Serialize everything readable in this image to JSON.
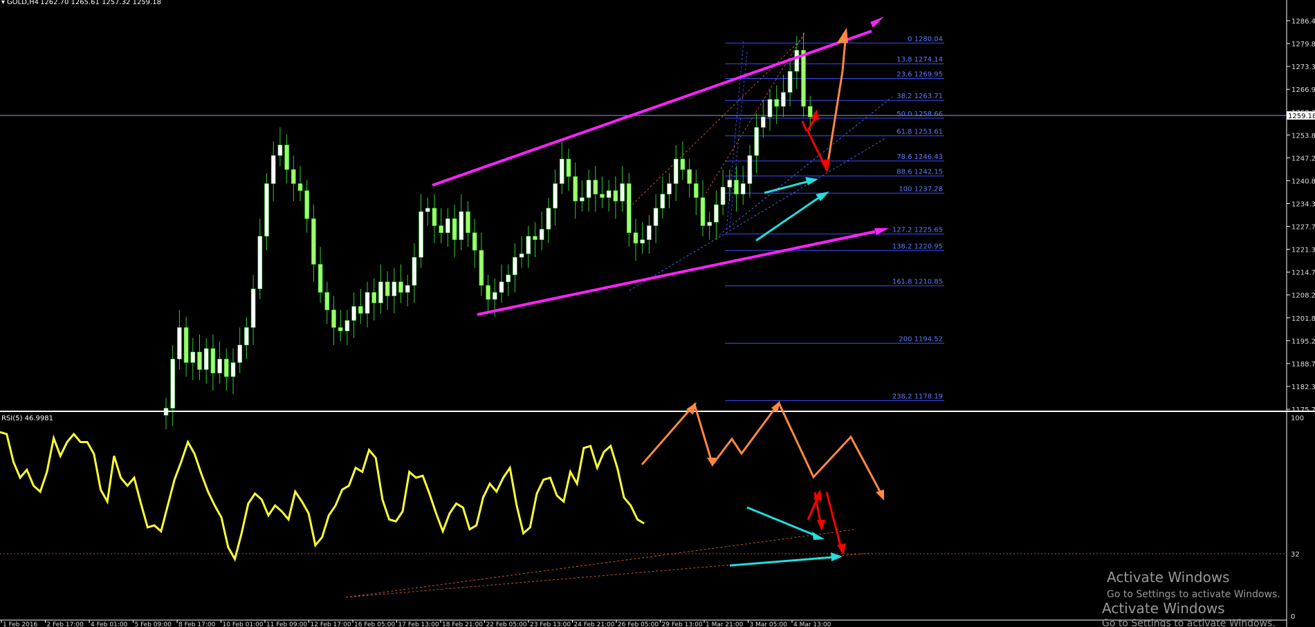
{
  "header": {
    "symbol": "GOLD,H4",
    "ohlc": "1262.70 1265.61 1257.32 1259.18"
  },
  "price_axis": {
    "ticks": [
      "1286.40",
      "1279.80",
      "1273.35",
      "1266.90",
      "1260.30",
      "1253.85",
      "1247.25",
      "1240.80",
      "1234.35",
      "1227.75",
      "1221.30",
      "1214.70",
      "1208.25",
      "1201.80",
      "1195.20",
      "1188.75",
      "1182.30",
      "1175.70"
    ],
    "current_price": "1259.18"
  },
  "rsi": {
    "label": "RSI(5) 46.9981",
    "levels": [
      "100",
      "32",
      "0"
    ]
  },
  "time_axis": {
    "labels": [
      "1 Feb 2016",
      "2 Feb 17:00",
      "4 Feb 01:00",
      "5 Feb 09:00",
      "8 Feb 17:00",
      "10 Feb 01:00",
      "11 Feb 09:00",
      "12 Feb 17:00",
      "16 Feb 05:00",
      "17 Feb 13:00",
      "18 Feb 21:00",
      "22 Feb 05:00",
      "23 Feb 13:00",
      "24 Feb 21:00",
      "26 Feb 05:00",
      "29 Feb 13:00",
      "1 Mar 21:00",
      "3 Mar 05:00",
      "4 Mar 13:00"
    ]
  },
  "fibonacci": [
    {
      "ratio": "0",
      "price": "1280.04"
    },
    {
      "ratio": "13.8",
      "price": "1274.14"
    },
    {
      "ratio": "23.6",
      "price": "1269.95"
    },
    {
      "ratio": "38.2",
      "price": "1263.71"
    },
    {
      "ratio": "50.0",
      "price": "1258.66"
    },
    {
      "ratio": "61.8",
      "price": "1253.61"
    },
    {
      "ratio": "78.6",
      "price": "1246.43"
    },
    {
      "ratio": "88.6",
      "price": "1242.15"
    },
    {
      "ratio": "100",
      "price": "1237.28"
    },
    {
      "ratio": "127.2",
      "price": "1225.65"
    },
    {
      "ratio": "138.2",
      "price": "1220.95"
    },
    {
      "ratio": "161.8",
      "price": "1210.85"
    },
    {
      "ratio": "200",
      "price": "1194.52"
    },
    {
      "ratio": "238.2",
      "price": "1178.19"
    }
  ],
  "watermark": {
    "line1": "Activate Windows",
    "line2": "Go to Settings to activate Windows.",
    "line3": "Activate Windows",
    "line4": "Go to Settings to activate Windows."
  },
  "colors": {
    "background": "#000000",
    "candle_up": "#ffffff",
    "candle_down": "#9cff6a",
    "wick": "#33cc33",
    "rsi_line": "#ffff33",
    "channel": "#ff22ff",
    "fib": "#4466ff",
    "arrow_orange": "#ff8844",
    "arrow_red": "#ff0000",
    "arrow_cyan": "#22dddd"
  },
  "chart_data": {
    "type": "candlestick",
    "title": "GOLD,H4",
    "ylim": [
      1175.7,
      1286.4
    ],
    "close_series": [
      1176,
      1190,
      1199,
      1189,
      1192,
      1187,
      1193,
      1186,
      1190,
      1185,
      1189,
      1194,
      1199,
      1210,
      1225,
      1240,
      1248,
      1251,
      1244,
      1240,
      1238,
      1230,
      1217,
      1209,
      1204,
      1199,
      1198,
      1201,
      1205,
      1203,
      1209,
      1206,
      1212,
      1208,
      1212,
      1209,
      1211,
      1219,
      1232,
      1233,
      1228,
      1226,
      1230,
      1224,
      1232,
      1226,
      1221,
      1211,
      1207,
      1209,
      1212,
      1214,
      1219,
      1220,
      1225,
      1224,
      1227,
      1233,
      1240,
      1247,
      1242,
      1235,
      1236,
      1241,
      1237,
      1236,
      1238,
      1235,
      1240,
      1226,
      1223,
      1224,
      1228,
      1233,
      1237,
      1240,
      1247,
      1244,
      1240,
      1236,
      1228,
      1229,
      1234,
      1239,
      1241,
      1237,
      1240,
      1248,
      1256,
      1259,
      1264,
      1262,
      1266,
      1272,
      1278,
      1262,
      1259
    ],
    "rsi_series": [
      93,
      92,
      78,
      70,
      74,
      66,
      63,
      73,
      90,
      81,
      88,
      92,
      88,
      88,
      82,
      64,
      58,
      81,
      70,
      66,
      70,
      57,
      45,
      46,
      43,
      56,
      69,
      78,
      88,
      82,
      72,
      63,
      56,
      50,
      35,
      29,
      42,
      57,
      62,
      59,
      51,
      56,
      53,
      49,
      63,
      58,
      52,
      36,
      40,
      51,
      56,
      64,
      66,
      75,
      73,
      84,
      80,
      59,
      49,
      48,
      53,
      73,
      70,
      71,
      62,
      52,
      43,
      52,
      57,
      55,
      44,
      46,
      60,
      67,
      63,
      70,
      75,
      56,
      42,
      45,
      62,
      69,
      70,
      61,
      58,
      73,
      67,
      85,
      86,
      75,
      83,
      86,
      75,
      60,
      56,
      49,
      47
    ]
  }
}
